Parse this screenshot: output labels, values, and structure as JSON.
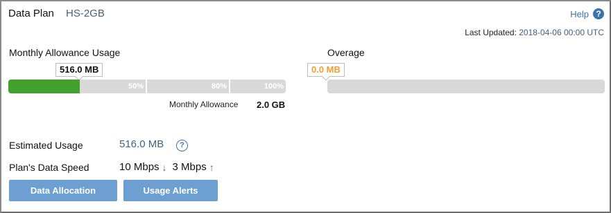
{
  "header": {
    "label": "Data Plan",
    "plan_name": "HS-2GB",
    "help_label": "Help",
    "help_icon": "?",
    "last_updated_label": "Last Updated:",
    "last_updated_value": "2018-04-06 00:00 UTC"
  },
  "monthly": {
    "title": "Monthly Allowance Usage",
    "used_label": "516.0 MB",
    "used_fraction": 0.258,
    "marks": [
      "50%",
      "80%",
      "100%"
    ],
    "allowance_label": "Monthly Allowance",
    "allowance_value": "2.0 GB",
    "fill_color": "#41a12c"
  },
  "overage": {
    "title": "Overage",
    "value_label": "0.0 MB",
    "fraction": 0,
    "value_color": "#f0a030"
  },
  "estimated": {
    "label": "Estimated Usage",
    "value": "516.0 MB",
    "info_icon": "?"
  },
  "speed": {
    "label": "Plan's Data Speed",
    "down": "10 Mbps",
    "down_icon": "↓",
    "up": "3 Mbps",
    "up_icon": "↑"
  },
  "buttons": {
    "data_allocation": "Data Allocation",
    "usage_alerts": "Usage Alerts"
  }
}
